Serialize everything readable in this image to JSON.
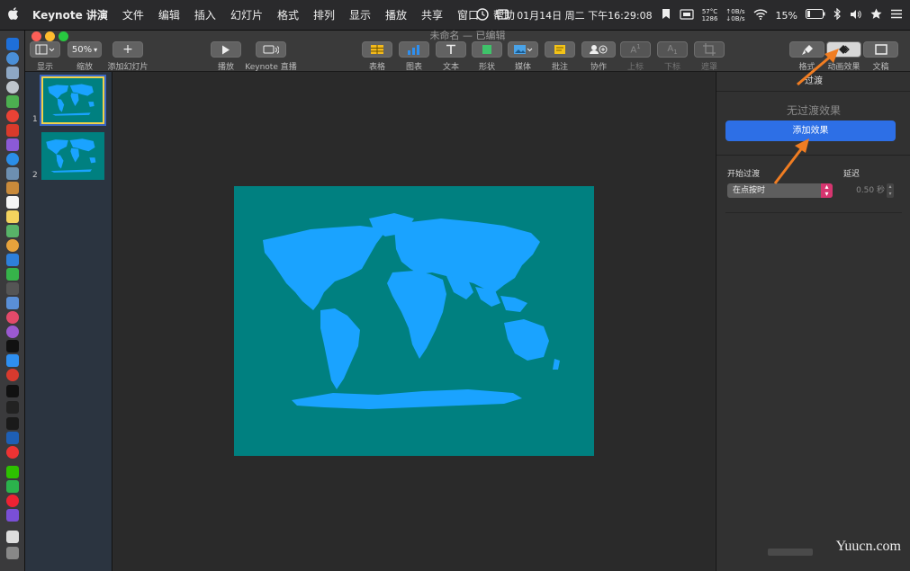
{
  "menubar": {
    "apple": "",
    "app_name": "Keynote 讲演",
    "items": [
      "文件",
      "编辑",
      "插入",
      "幻灯片",
      "格式",
      "排列",
      "显示",
      "播放",
      "共享",
      "窗口",
      "帮助"
    ],
    "datetime": "01月14日 周二 下午16:29:08",
    "temp_top": "57°C",
    "temp_bottom": "1286",
    "net_up": "0B/s",
    "net_down": "0B/s",
    "battery": "15%"
  },
  "window": {
    "title": "未命名 — 已编辑",
    "toolbar": {
      "view": "显示",
      "zoom_value": "50%",
      "zoom": "缩放",
      "add_slide": "添加幻灯片",
      "play": "播放",
      "live": "Keynote 直播",
      "table": "表格",
      "chart": "图表",
      "text": "文本",
      "shape": "形状",
      "media": "媒体",
      "comment": "批注",
      "collab": "协作",
      "superscript": "上标",
      "subscript": "下标",
      "mask": "遮罩",
      "format": "格式",
      "animate": "动画效果",
      "document": "文稿"
    },
    "slides": [
      {
        "num": "1"
      },
      {
        "num": "2"
      }
    ]
  },
  "inspector": {
    "tab": "过渡",
    "no_transition": "无过渡效果",
    "add_effect": "添加效果",
    "start_label": "开始过渡",
    "start_value": "在点按时",
    "delay_label": "延迟",
    "delay_value": "0.50 秒"
  },
  "colors": {
    "slide_bg": "#008080",
    "continents": "#1aa3ff",
    "accent": "#2d6fe6",
    "annotation": "#f07d22"
  },
  "watermark": "Yuucn.com"
}
